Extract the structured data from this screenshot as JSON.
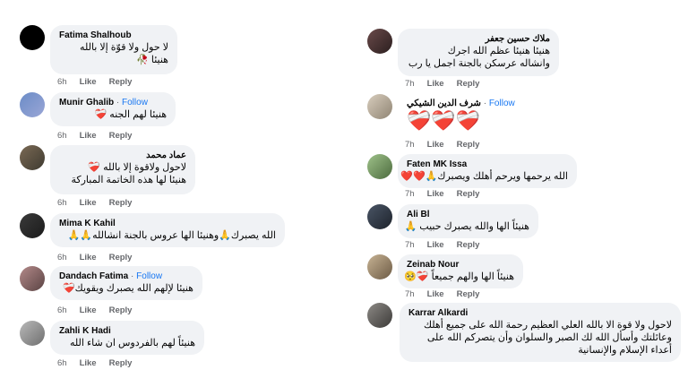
{
  "left": [
    {
      "name": "Fatima Shalhoub",
      "follow": "",
      "lines": [
        "لا حول ولا قوّة إلا بالله",
        "هنيئا 🥀"
      ],
      "time": "6h",
      "like": "Like",
      "reply": "Reply"
    },
    {
      "name": "Munir Ghalib",
      "follow": "Follow",
      "lines": [
        "هنيئا لهم الجنه ❤️‍🩹"
      ],
      "time": "6h",
      "like": "Like",
      "reply": "Reply"
    },
    {
      "name": "عماد محمد",
      "follow": "",
      "lines": [
        "لاحول ولاقوة إلا بالله ❤️‍🩹",
        "هنيئا لها هذه الخاتمة المباركة"
      ],
      "time": "6h",
      "like": "Like",
      "reply": "Reply"
    },
    {
      "name": "Mima K Kahil",
      "follow": "",
      "lines": [
        "الله يصبرك🙏وهنيئا الها عروس بالجنة انشالله🙏🙏"
      ],
      "time": "6h",
      "like": "Like",
      "reply": "Reply"
    },
    {
      "name": "Dandach Fatima",
      "follow": "Follow",
      "lines": [
        "هنيئا لإلهم الله يصبرك ويقويك❤️‍🩹"
      ],
      "time": "6h",
      "like": "Like",
      "reply": "Reply"
    },
    {
      "name": "Zahli K Hadi",
      "follow": "",
      "lines": [
        "هنيئاً لهم بالفردوس ان شاء الله"
      ],
      "time": "6h",
      "like": "Like",
      "reply": "Reply"
    }
  ],
  "right": [
    {
      "name": "ملاك حسين جعفر",
      "follow": "",
      "lines": [
        "هنيئا هنيئا عظم الله اجرك",
        "وانشاله عرسكن بالجنة اجمل يا رب"
      ],
      "time": "7h",
      "like": "Like",
      "reply": "Reply"
    },
    {
      "name": "شرف الدين الشيكي",
      "follow": "Follow",
      "lines": [
        "❤️‍🩹❤️‍🩹❤️‍🩹"
      ],
      "time": "7h",
      "like": "Like",
      "reply": "Reply"
    },
    {
      "name": "Faten MK Issa",
      "follow": "",
      "lines": [
        "الله يرحمها ويرحم أهلك ويصبرك🙏❤️❤️"
      ],
      "time": "7h",
      "like": "Like",
      "reply": "Reply"
    },
    {
      "name": "Ali Bl",
      "follow": "",
      "lines": [
        "هنيئاً الها والله يصبرك حبيب 🙏"
      ],
      "time": "7h",
      "like": "Like",
      "reply": "Reply"
    },
    {
      "name": "Zeinab Nour",
      "follow": "",
      "lines": [
        "هنيئاً الها والهم جميعاً ❤️‍🩹🥺"
      ],
      "time": "7h",
      "like": "Like",
      "reply": "Reply"
    },
    {
      "name": "Karrar Alkardi",
      "follow": "",
      "lines": [
        "لاحول ولا قوة الا بالله العلي العظيم رحمة الله على جميع أهلك",
        "وعائلتك وأسأل الله لك الصبر والسلوان وأن يتصركم الله على",
        "أعداء الإسلام والإنسانية"
      ],
      "time": "7h",
      "like": "Like",
      "reply": "Reply"
    }
  ],
  "colors": {
    "bubble": "#f0f2f5",
    "link": "#1877f2",
    "meta": "#65676b"
  }
}
